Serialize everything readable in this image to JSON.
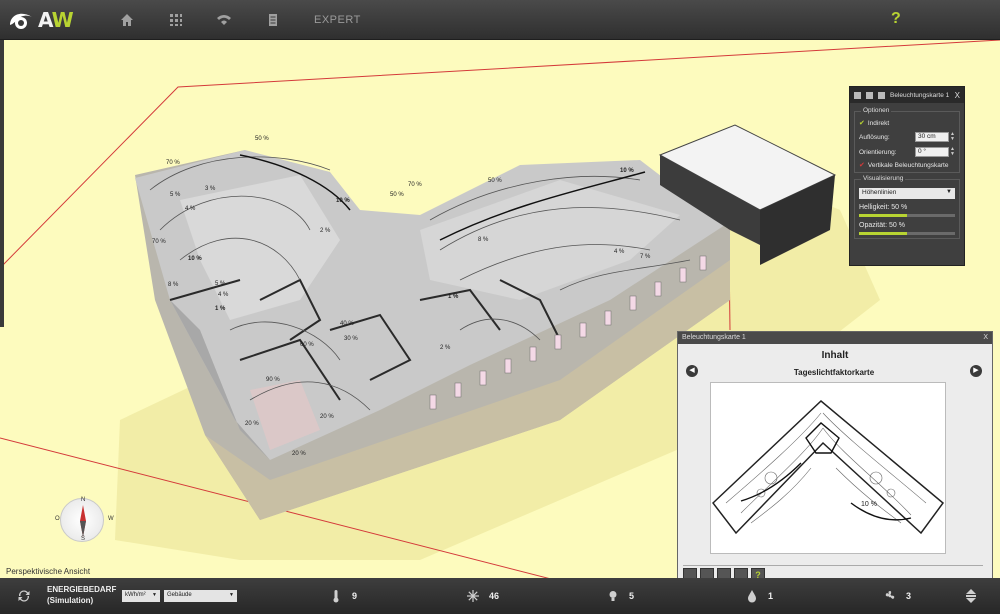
{
  "app": {
    "logo_text_a": "A",
    "logo_text_w": "W"
  },
  "topnav": {
    "items": [
      {
        "icon": "home-icon"
      },
      {
        "icon": "grid-icon"
      },
      {
        "icon": "wifi-icon"
      },
      {
        "icon": "document-icon"
      }
    ],
    "expert_label": "EXPERT",
    "help_label": "?"
  },
  "viewport": {
    "view_label": "Perspektivische Ansicht",
    "compass": {
      "n": "N",
      "s": "S",
      "o": "O",
      "w": "W"
    },
    "contour_labels": [
      "70 %",
      "50 %",
      "40 %",
      "10 %",
      "8 %",
      "3 %",
      "4 %",
      "5 %",
      "2 %",
      "1 %",
      "20 %",
      "60 %",
      "30 %",
      "90 %"
    ],
    "accent_color": "#b8d432",
    "bg_color": "#fdfbbe"
  },
  "options_panel": {
    "title": "Beleuchtungskarte 1",
    "close": "X",
    "optionen_legend": "Optionen",
    "indirekt": "Indirekt",
    "aufloesung_label": "Auflösung:",
    "aufloesung_value": "30 cm",
    "orientierung_label": "Orientierung:",
    "orientierung_value": "0 °",
    "vertikale": "Vertikale Beleuchtungskarte",
    "visual_legend": "Visualisierung",
    "visual_value": "Höhenlinien",
    "helligkeit_label": "Helligkeit: 50 %",
    "helligkeit_value": 0.5,
    "opazitaet_label": "Opazität: 50 %",
    "opazitaet_value": 0.5
  },
  "map_panel": {
    "header": "Beleuchtungskarte 1",
    "close": "X",
    "title": "Inhalt",
    "subtitle": "Tageslichtfaktorkarte",
    "map_label": "10 %"
  },
  "bottombar": {
    "energy_line1": "ENERGIEBEDARF",
    "energy_line2": "(Simulation)",
    "unit_select": "kWh/m²",
    "scope_select": "Gebäude",
    "stats": [
      {
        "icon": "thermometer-icon",
        "value": "9"
      },
      {
        "icon": "sun-icon",
        "value": "46"
      },
      {
        "icon": "bulb-icon",
        "value": "5"
      },
      {
        "icon": "drop-icon",
        "value": "1"
      },
      {
        "icon": "fan-icon",
        "value": "3"
      }
    ]
  }
}
